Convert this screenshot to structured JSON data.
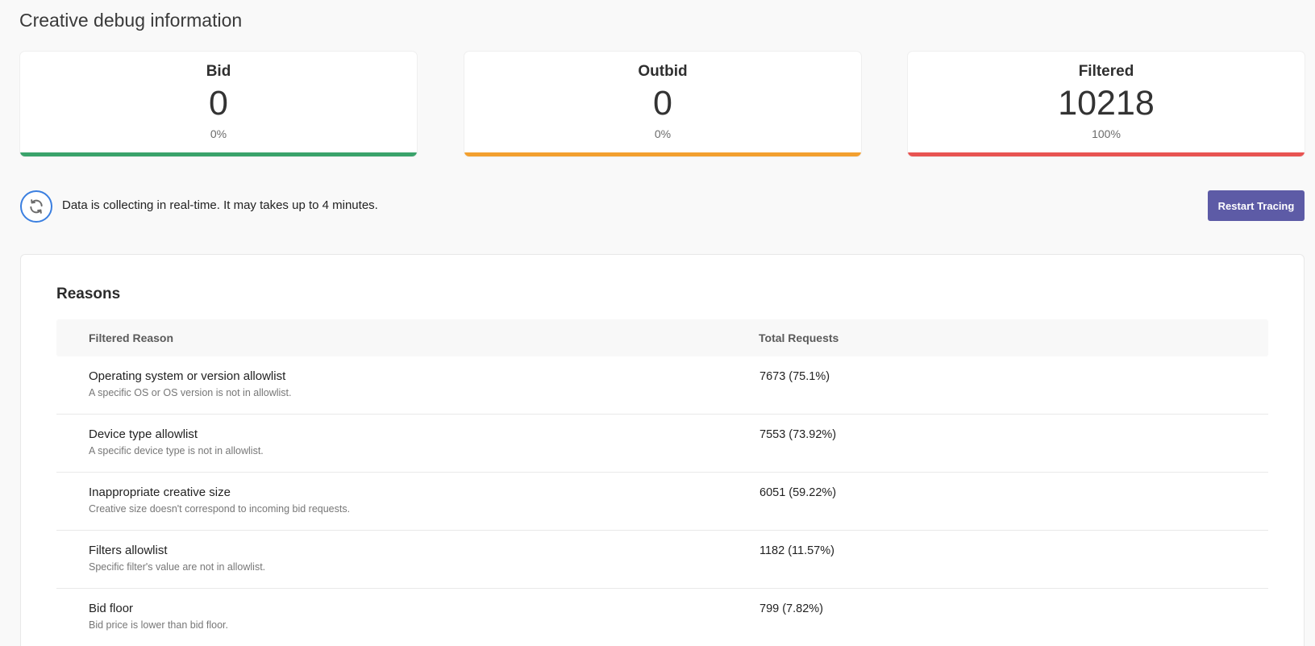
{
  "page": {
    "title": "Creative debug information"
  },
  "stats": [
    {
      "label": "Bid",
      "value": "0",
      "percent": "0%",
      "color": "#3aa36b"
    },
    {
      "label": "Outbid",
      "value": "0",
      "percent": "0%",
      "color": "#f3a02f"
    },
    {
      "label": "Filtered",
      "value": "10218",
      "percent": "100%",
      "color": "#e85452"
    }
  ],
  "notice": {
    "text": "Data is collecting in real-time. It may takes up to 4 minutes.",
    "icon": "refresh-icon",
    "icon_color": "#3b7fe0"
  },
  "actions": {
    "restart_label": "Restart Tracing",
    "restart_color": "#5d5ba6"
  },
  "reasons": {
    "title": "Reasons",
    "columns": {
      "reason": "Filtered Reason",
      "total": "Total Requests"
    },
    "rows": [
      {
        "name": "Operating system or version allowlist",
        "desc": "A specific OS or OS version is not in allowlist.",
        "total": "7673 (75.1%)"
      },
      {
        "name": "Device type allowlist",
        "desc": "A specific device type is not in allowlist.",
        "total": "7553 (73.92%)"
      },
      {
        "name": "Inappropriate creative size",
        "desc": "Creative size doesn't correspond to incoming bid requests.",
        "total": "6051 (59.22%)"
      },
      {
        "name": "Filters allowlist",
        "desc": "Specific filter's value are not in allowlist.",
        "total": "1182 (11.57%)"
      },
      {
        "name": "Bid floor",
        "desc": "Bid price is lower than bid floor.",
        "total": "799 (7.82%)"
      }
    ]
  }
}
